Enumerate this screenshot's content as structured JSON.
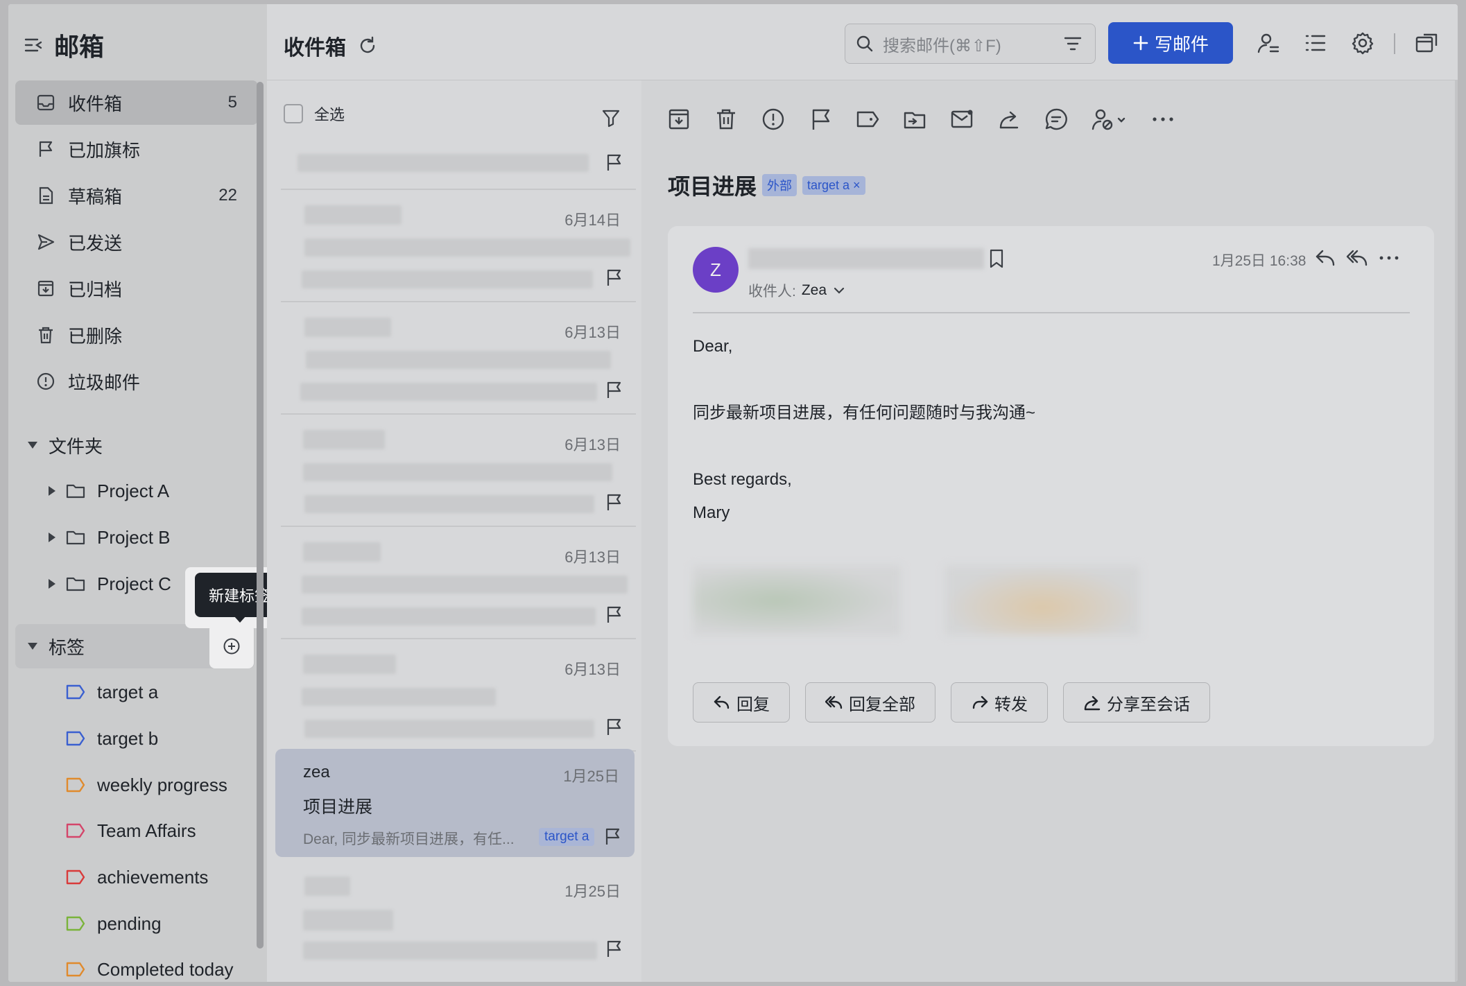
{
  "sidebar": {
    "title": "邮箱",
    "items": [
      {
        "label": "收件箱",
        "count": "5",
        "icon": "inbox-icon"
      },
      {
        "label": "已加旗标",
        "count": "",
        "icon": "flag-icon"
      },
      {
        "label": "草稿箱",
        "count": "22",
        "icon": "draft-icon"
      },
      {
        "label": "已发送",
        "count": "",
        "icon": "send-icon"
      },
      {
        "label": "已归档",
        "count": "",
        "icon": "archive-icon"
      },
      {
        "label": "已删除",
        "count": "",
        "icon": "trash-icon"
      },
      {
        "label": "垃圾邮件",
        "count": "",
        "icon": "spam-icon"
      }
    ],
    "folders_title": "文件夹",
    "folders": [
      "Project A",
      "Project B",
      "Project C"
    ],
    "tags_title": "标签",
    "tags": [
      {
        "label": "target a",
        "color": "#3a5fd0"
      },
      {
        "label": "target b",
        "color": "#3a5fd0"
      },
      {
        "label": "weekly progress",
        "color": "#e08a2c"
      },
      {
        "label": "Team Affairs",
        "color": "#d4456a"
      },
      {
        "label": "achievements",
        "color": "#d93a3a"
      },
      {
        "label": "pending",
        "color": "#7ab33a"
      },
      {
        "label": "Completed today",
        "color": "#e08a2c"
      }
    ],
    "tooltip": "新建标签"
  },
  "topbar": {
    "title": "收件箱",
    "search_placeholder": "搜索邮件(⌘⇧F)",
    "compose_label": "写邮件"
  },
  "list": {
    "select_all": "全选",
    "dates": [
      "6月14日",
      "6月13日",
      "6月13日",
      "6月13日",
      "6月13日"
    ],
    "selected": {
      "from": "zea",
      "date": "1月25日",
      "subject": "项目进展",
      "preview": "Dear, 同步最新项目进展，有任...",
      "tag": "target a"
    },
    "last_date": "1月25日"
  },
  "mail": {
    "subject": "项目进展",
    "chip_external": "外部",
    "chip_tag": "target a ×",
    "avatar_letter": "Z",
    "recipient_label": "收件人:",
    "recipient": "Zea",
    "time": "1月25日 16:38",
    "body": [
      "Dear,",
      "同步最新项目进展，有任何问题随时与我沟通~",
      "Best regards,",
      "Mary"
    ],
    "buttons": {
      "reply": "回复",
      "reply_all": "回复全部",
      "forward": "转发",
      "share": "分享至会话"
    }
  },
  "colors": {
    "accent": "#2b55c8",
    "avatar": "#6b3fc6"
  }
}
